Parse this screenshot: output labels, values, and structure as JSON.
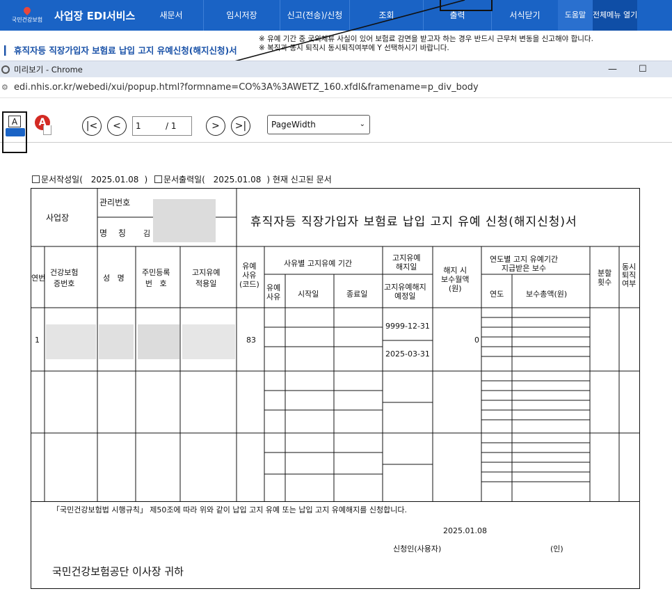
{
  "topbar": {
    "logo_text": "국민건강보험",
    "brand": "사업장 EDI서비스",
    "menu": [
      "새문서",
      "임시저장",
      "신고(전송)/신청",
      "조회",
      "출력",
      "서식닫기"
    ],
    "help": "도움말",
    "all_menu": "전체메뉴 열기"
  },
  "subtitle": "휴직자등 직장가입자 보험료 납입 고지 유예신청(해지신청)서",
  "notices": [
    "※ 유예 기간 중 국외체류 사실이 있어 보험료 감면을 받고자 하는 경우 반드시 근무처 변동을 신고해야 합니다.",
    "※ 복직과 동시 퇴직시 동시퇴직여부에 Y 선택하시기 바랍니다."
  ],
  "chrome": {
    "title": "미리보기 - Chrome",
    "minimize": "—",
    "maximize": "☐",
    "url": "edi.nhis.or.kr/webedi/xui/popup.html?formname=CO%3A%3AWETZ_160.xfdl&framename=p_div_body"
  },
  "viewer": {
    "print_label": "A",
    "pdf_label": "A",
    "first": "|<",
    "prev": "<",
    "next": ">",
    "last": ">|",
    "page": "1",
    "total": "/ 1",
    "zoom": "PageWidth",
    "caret": "⌄"
  },
  "form": {
    "status": {
      "written_label": "문서작성일(",
      "written_date": "2025.01.08",
      "close1": ")",
      "printed_label": "문서출력일(",
      "printed_date": "2025.01.08",
      "close2": ") 현재 신고된 문서"
    },
    "header": {
      "workplace": "사업장",
      "mgmt_no": "관리번호",
      "name_label": "명  칭",
      "name_value": "김",
      "title": "휴직자등 직장가입자 보험료 납입 고지 유예 신청(해지신청)서"
    },
    "columns": {
      "seq": "연번",
      "health_no": "건강보험\n증번호",
      "name": "성   명",
      "rrn": "주민등록\n번   호",
      "apply_date": "고지유예\n적용일",
      "reason_code": "유예\n사유\n(코드)",
      "period_group": "사유별 고지유예 기간",
      "reason": "유예\n사유",
      "start": "시작일",
      "end": "종료일",
      "cancel_date": "고지유예\n해지일",
      "cancel_planned": "고지유예해지\n예정일",
      "pay_label": "해지 시\n보수월액\n(원)",
      "yearly_group": "연도별 고지 유예기간\n지급받은 보수",
      "year": "연도",
      "pay_total": "보수총액(원)",
      "installments": "분할\n횟수",
      "simul_resign": "동시\n퇴직\n여부"
    },
    "row1": {
      "seq": "1",
      "reason_code": "83",
      "cancel_date": "9999-12-31",
      "planned_date": "2025-03-31",
      "pay": "0"
    },
    "footer": {
      "statement": "「국민건강보험법 시행규칙」 제50조에 따라 위와 같이 납입 고지 유예 또는 납입 고지 유예해지를 신청합니다.",
      "date": "2025.01.08",
      "applicant": "신청인(사용자)",
      "seal": "(인)",
      "recipient": "국민건강보험공단   이사장 귀하"
    }
  }
}
